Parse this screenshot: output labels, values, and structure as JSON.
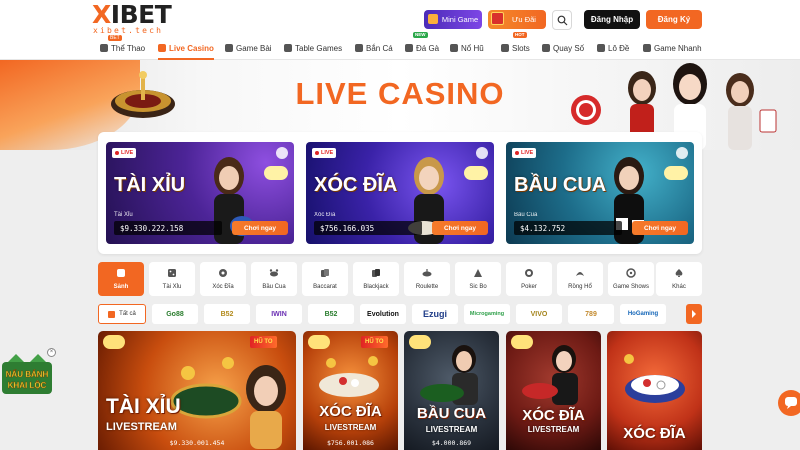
{
  "header": {
    "logo": {
      "brand": "XIBET",
      "sub": "xibet.tech",
      "badge": "BET"
    },
    "mini_game": "Mini Game",
    "uu_dai": "Ưu Đãi",
    "login": "Đăng Nhập",
    "register": "Đăng Ký",
    "nav": [
      {
        "label": "Thể Thao",
        "icon": "soccer-icon"
      },
      {
        "label": "Live Casino",
        "icon": "casino-icon",
        "active": true
      },
      {
        "label": "Game Bài",
        "icon": "cards-icon"
      },
      {
        "label": "Table Games",
        "icon": "table-icon"
      },
      {
        "label": "Bắn Cá",
        "icon": "fish-icon"
      },
      {
        "label": "Đá Gà",
        "icon": "rooster-icon",
        "badge": "NEW"
      },
      {
        "label": "Nổ Hũ",
        "icon": "jackpot-icon"
      },
      {
        "label": "Slots",
        "icon": "slot-icon",
        "badge": "HOT"
      },
      {
        "label": "Quay Số",
        "icon": "lottery-icon"
      },
      {
        "label": "Lô Đề",
        "icon": "lotto-icon"
      },
      {
        "label": "Game Nhanh",
        "icon": "lightning-icon"
      }
    ]
  },
  "banner": {
    "title": "LIVE CASINO"
  },
  "featured": [
    {
      "title": "TÀI XỈU",
      "sub": "Tài Xỉu",
      "amount": "$9.330.222.158",
      "play": "Chơi ngay",
      "live": "LIVE"
    },
    {
      "title": "XÓC ĐĨA",
      "sub": "Xóc Đĩa",
      "amount": "$756.166.035",
      "play": "Chơi ngay",
      "live": "LIVE"
    },
    {
      "title": "BẦU CUA",
      "sub": "Bầu Cua",
      "amount": "$4.132.752",
      "play": "Chơi ngay",
      "live": "LIVE"
    }
  ],
  "categories": [
    {
      "label": "Sảnh",
      "icon": "lobby-icon",
      "active": true
    },
    {
      "label": "Tài Xỉu",
      "icon": "dice-icon"
    },
    {
      "label": "Xóc Đĩa",
      "icon": "disc-icon"
    },
    {
      "label": "Bầu Cua",
      "icon": "crab-icon"
    },
    {
      "label": "Baccarat",
      "icon": "baccarat-icon"
    },
    {
      "label": "Blackjack",
      "icon": "blackjack-icon"
    },
    {
      "label": "Roulette",
      "icon": "roulette-icon"
    },
    {
      "label": "Sic Bo",
      "icon": "sicbo-icon"
    },
    {
      "label": "Poker",
      "icon": "poker-icon"
    },
    {
      "label": "Rồng Hổ",
      "icon": "dragon-tiger-icon"
    },
    {
      "label": "Game Shows",
      "icon": "gameshow-icon"
    },
    {
      "label": "Khác",
      "icon": "spade-icon"
    }
  ],
  "providers": [
    {
      "label": "Tất cả"
    },
    {
      "label": "Go88",
      "color": "#2a7d2e"
    },
    {
      "label": "B52",
      "color": "#b38b1c"
    },
    {
      "label": "IWIN",
      "color": "#6a2fb3"
    },
    {
      "label": "B52",
      "color": "#2a7d2e"
    },
    {
      "label": "Evolution",
      "color": "#111111"
    },
    {
      "label": "Ezugi",
      "color": "#1f3c88"
    },
    {
      "label": "Microgaming",
      "color": "#2fa04a"
    },
    {
      "label": "VIVO",
      "color": "#a4841c"
    },
    {
      "label": "789",
      "color": "#c2892c"
    },
    {
      "label": "HoGaming",
      "color": "#1466b8"
    }
  ],
  "tiles": [
    {
      "title": "TÀI XỈU",
      "sub": "LIVESTREAM",
      "amount": "$9.330.001.454",
      "tag": "HŨ TO"
    },
    {
      "title": "XÓC ĐĨA",
      "sub": "LIVESTREAM",
      "amount": "$756.001.086",
      "tag": "HŨ TO"
    },
    {
      "title": "BẦU CUA",
      "sub": "LIVESTREAM",
      "amount": "$4.000.869"
    },
    {
      "title": "XÓC ĐĨA",
      "sub": "LIVESTREAM",
      "amount": ""
    },
    {
      "title": "XÓC ĐĨA",
      "sub": "",
      "amount": ""
    }
  ],
  "promo_float": {
    "text_line1": "NẤU BÁNH",
    "text_line2": "KHAI LỘC"
  }
}
